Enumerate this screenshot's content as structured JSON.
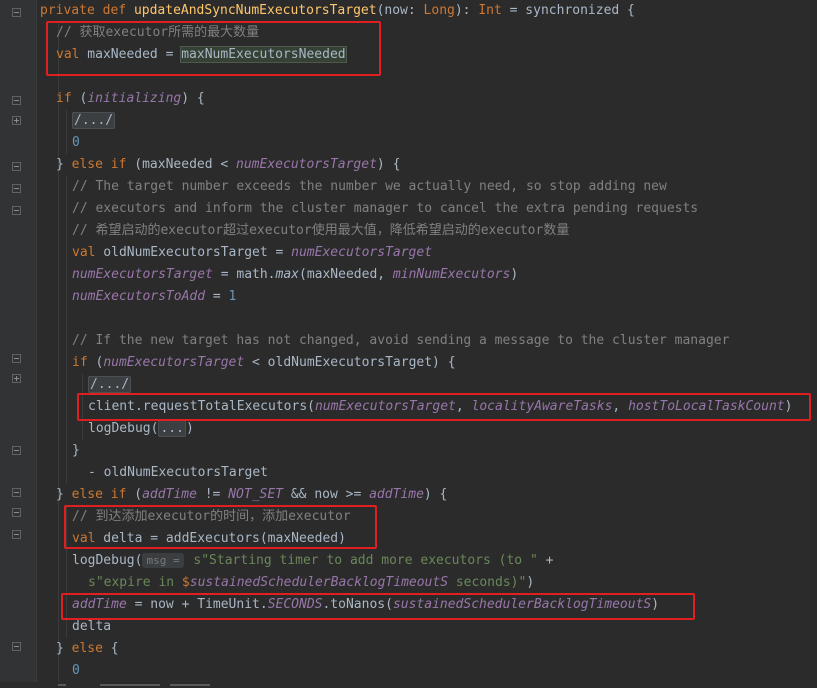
{
  "code": {
    "l1": {
      "private": "private",
      "def": "def",
      "fname": "updateAndSyncNumExecutorsTarget",
      "p1": "(now: ",
      "Long": "Long",
      "p2": "): ",
      "Int": "Int",
      "p3": " = synchronized {"
    },
    "l2": {
      "comment": "// 获取executor所需的最大数量"
    },
    "l3": {
      "val": "val",
      "name": " maxNeeded = ",
      "call": "maxNumExecutorsNeeded"
    },
    "l4": {
      "if": "if",
      "p1": " (",
      "init": "initializing",
      "p2": ") {"
    },
    "l5": {
      "fold": "/.../"
    },
    "l6": {
      "zero": "0"
    },
    "l7": {
      "p0": "} ",
      "else": "else",
      "if": "if",
      "p1": " (maxNeeded < ",
      "target": "numExecutorsTarget",
      "p2": ") {"
    },
    "l8": {
      "comment": "// The target number exceeds the number we actually need, so stop adding new"
    },
    "l9": {
      "comment": "// executors and inform the cluster manager to cancel the extra pending requests"
    },
    "l10": {
      "comment": "// 希望启动的executor超过executor使用最大值，降低希望启动的executor数量"
    },
    "l11": {
      "val": "val",
      "p1": " oldNumExecutorsTarget = ",
      "target": "numExecutorsTarget"
    },
    "l12": {
      "target": "numExecutorsTarget",
      "p1": " = math.",
      "max": "max",
      "p2": "(maxNeeded, ",
      "min": "minNumExecutors",
      "p3": ")"
    },
    "l13": {
      "toAdd": "numExecutorsToAdd",
      "p1": " = ",
      "one": "1"
    },
    "l14": {
      "comment": "// If the new target has not changed, avoid sending a message to the cluster manager"
    },
    "l15": {
      "if": "if",
      "p1": " (",
      "target": "numExecutorsTarget",
      "p2": " < oldNumExecutorsTarget) {"
    },
    "l16": {
      "fold": "/.../"
    },
    "l17": {
      "p1": "client.requestTotalExecutors(",
      "a1": "numExecutorsTarget",
      "c1": ", ",
      "a2": "localityAwareTasks",
      "c2": ", ",
      "a3": "hostToLocalTaskCount",
      "p2": ")"
    },
    "l18": {
      "p1": "logDebug(",
      "fold": "...",
      "p2": ")"
    },
    "l19": {
      "p1": "}"
    },
    "l20": {
      "p1": "- oldNumExecutorsTarget"
    },
    "l21": {
      "p0": "} ",
      "else": "else",
      "if": "if",
      "p1": " (",
      "addTime": "addTime",
      "p2": " != ",
      "notSet": "NOT_SET",
      "p3": " && now >= ",
      "addTime2": "addTime",
      "p4": ") {"
    },
    "l22": {
      "comment": "// 到达添加executor的时间，添加executor"
    },
    "l23": {
      "val": "val",
      "p1": " delta = addExecutors(maxNeeded)"
    },
    "l24": {
      "p1": "logDebug(",
      "hint": "msg =",
      "str": " s\"Starting timer to add more executors (to \"",
      "p2": " +"
    },
    "l25": {
      "str1": "s\"expire in ",
      "dollar": "$",
      "var": "sustainedSchedulerBacklogTimeoutS",
      "str2": " seconds)\"",
      "p1": ")"
    },
    "l26": {
      "addTime": "addTime",
      "p1": " = now + TimeUnit.",
      "secs": "SECONDS",
      "p2": ".toNanos(",
      "var": "sustainedSchedulerBacklogTimeoutS",
      "p3": ")"
    },
    "l27": {
      "p1": "delta"
    },
    "l28": {
      "p0": "} ",
      "else": "else",
      "p1": " {"
    },
    "l29": {
      "zero": "0"
    }
  }
}
